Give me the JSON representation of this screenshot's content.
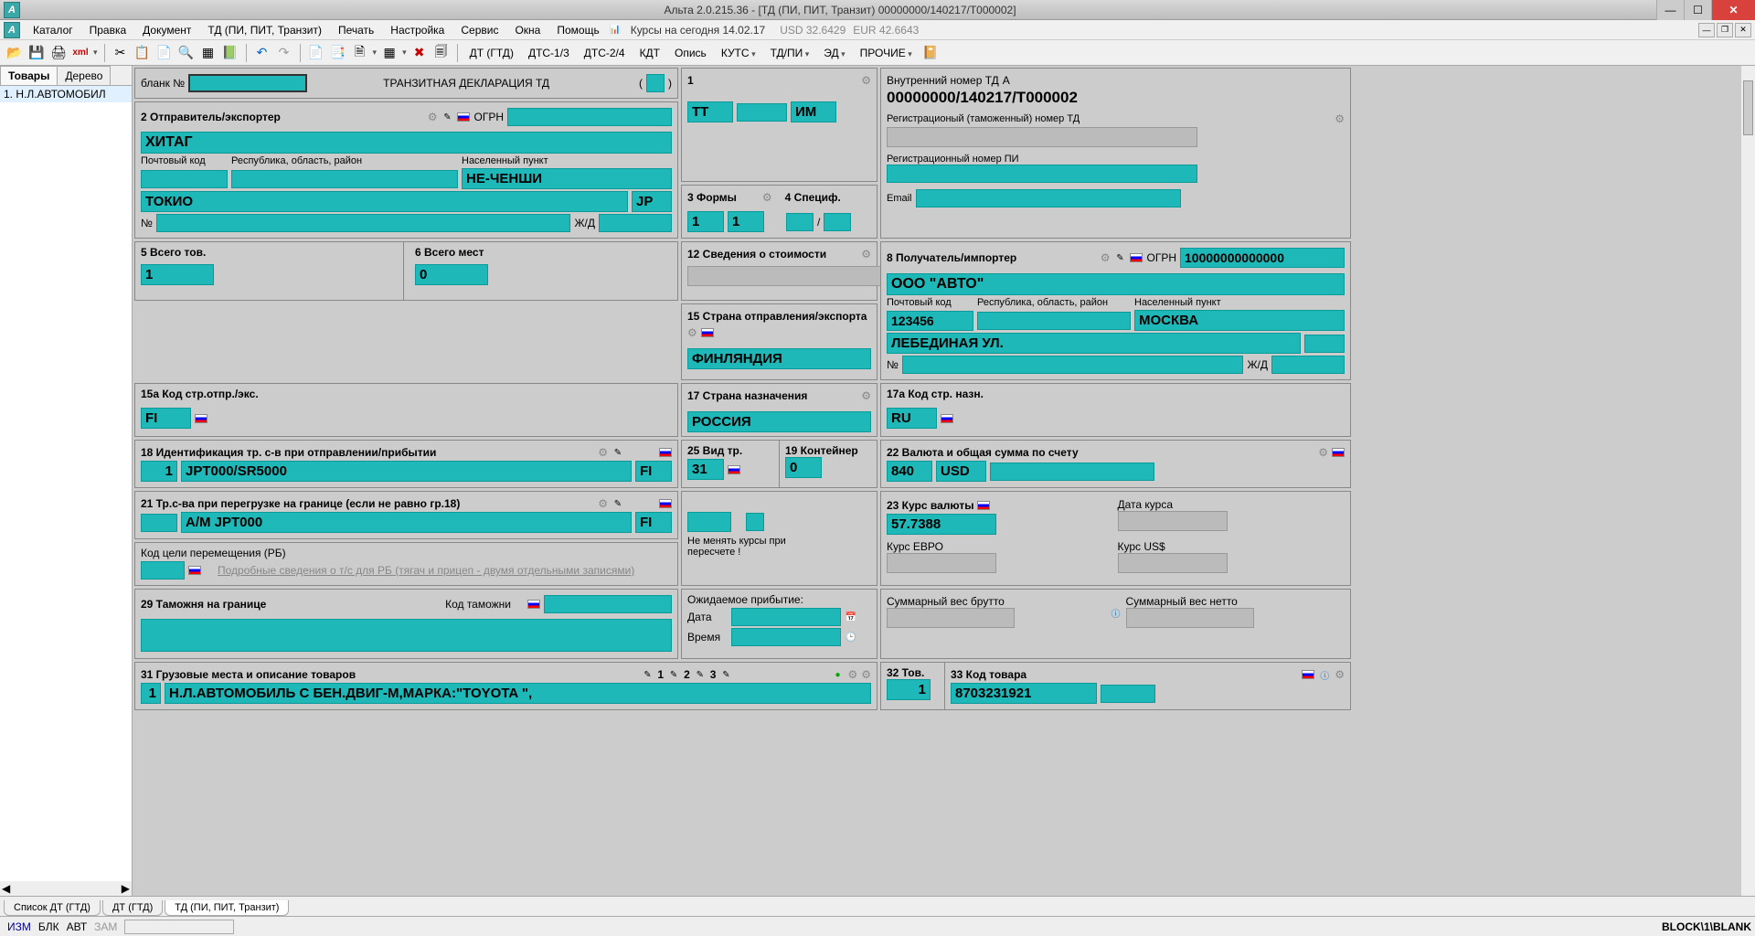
{
  "window": {
    "title": "Альта 2.0.215.36 - [ТД (ПИ, ПИТ, Транзит) 00000000/140217/Т000002]"
  },
  "menu": {
    "items": [
      "Каталог",
      "Правка",
      "Документ",
      "ТД (ПИ, ПИТ, Транзит)",
      "Печать",
      "Настройка",
      "Сервис",
      "Окна",
      "Помощь"
    ],
    "rates_label": "Курсы на сегодня 14.02.17",
    "rates_usd": "USD 32.6429",
    "rates_eur": "EUR 42.6643"
  },
  "toolbar2": {
    "items": [
      "ДТ (ГТД)",
      "ДТС-1/3",
      "ДТС-2/4",
      "КДТ",
      "Опись",
      "КУТС"
    ],
    "dd": [
      "ТД/ПИ",
      "ЭД",
      "ПРОЧИЕ"
    ]
  },
  "side": {
    "tab1": "Товары",
    "tab2": "Дерево",
    "item1": "1. Н.Л.АВТОМОБИЛ"
  },
  "header": {
    "blank": "бланк №",
    "decl_title": "ТРАНЗИТНАЯ ДЕКЛАРАЦИЯ  ТД",
    "r1_lbl": "1",
    "r1_tt": "ТТ",
    "r1_im": "ИМ",
    "inner_lbl": "Внутренний номер ТД",
    "inner_val": "00000000/140217/Т000002",
    "a": "A",
    "reg_custom": "Регистрационый (таможенный) номер ТД",
    "reg_pi": "Регистрационный номер ПИ",
    "email": "Email"
  },
  "b2": {
    "title": "2 Отправитель/экспортер",
    "ogrn": "ОГРН",
    "name": "ХИТАГ",
    "post": "Почтовый код",
    "region": "Республика, область, район",
    "city_lbl": "Населенный пункт",
    "city": "НЕ-ЧЕНШИ",
    "city2": "ТОКИО",
    "country": "JP",
    "no": "№",
    "zd": "Ж/Д"
  },
  "b3": {
    "forms": "3 Формы",
    "v1": "1",
    "v2": "1",
    "spec": "4 Специф.",
    "slash": "/"
  },
  "b5": {
    "total_goods": "5 Всего тов.",
    "v": "1",
    "total_places": "6 Всего мест",
    "p": "0"
  },
  "b12": {
    "lbl": "12 Сведения о стоимости"
  },
  "b8": {
    "title": "8 Получатель/импортер",
    "ogrn": "ОГРН",
    "ogrn_v": "10000000000000",
    "name": "ООО \"АВТО\"",
    "post": "Почтовый код",
    "post_v": "123456",
    "region": "Республика, область, район",
    "city_lbl": "Населенный пункт",
    "city": "МОСКВА",
    "street": "ЛЕБЕДИНАЯ УЛ.",
    "no": "№",
    "zd": "Ж/Д"
  },
  "b15": {
    "lbl": "15 Страна отправления/экспорта",
    "v": "ФИНЛЯНДИЯ",
    "lbl_a": "15a Код стр.отпр./экс.",
    "va": "FI"
  },
  "b17": {
    "lbl": "17 Страна назначения",
    "v": "РОССИЯ",
    "lbl_a": "17a Код стр. назн.",
    "va": "RU"
  },
  "b18": {
    "lbl": "18 Идентификация тр. с-в при отправлении/прибытии",
    "n": "1",
    "v": "JPT000/SR5000",
    "c": "FI"
  },
  "b21": {
    "lbl": "21 Тр.с-ва при перегрузке на границе (если не равно гр.18)",
    "v": "А/М JPT000",
    "c": "FI"
  },
  "b25": {
    "lbl": "25 Вид тр.",
    "v": "31"
  },
  "b19": {
    "lbl": "19 Контейнер",
    "v": "0"
  },
  "b22": {
    "lbl": "22 Валюта и общая сумма по счету",
    "code": "840",
    "cur": "USD"
  },
  "b23": {
    "keep": "Не менять курсы при пересчете !",
    "rate_lbl": "23 Курс валюты",
    "rate": "57.7388",
    "date_lbl": "Дата курса",
    "eur": "Курс ЕВРО",
    "usd": "Курс US$"
  },
  "brb": {
    "lbl": "Код цели перемещения (РБ)",
    "link": "Подробные сведения о т/с для РБ (тягач и прицеп - двумя отдельными записями)"
  },
  "b29": {
    "lbl": "29 Таможня на границе",
    "code": "Код таможни"
  },
  "barr": {
    "lbl": "Ожидаемое прибытие:",
    "date": "Дата",
    "time": "Время"
  },
  "bw": {
    "brutto": "Суммарный вес брутто",
    "netto": "Суммарный вес нетто"
  },
  "b31": {
    "lbl": "31 Грузовые места и описание товаров",
    "p1": "1",
    "p2": "2",
    "p3": "3",
    "n": "1",
    "desc": "Н.Л.АВТОМОБИЛЬ С БЕН.ДВИГ-М,МАРКА:\"TOYOTA \","
  },
  "b32": {
    "lbl": "32 Тов.",
    "v": "1"
  },
  "b33": {
    "lbl": "33 Код товара",
    "v": "8703231921"
  },
  "btabs": {
    "t1": "Список ДТ (ГТД)",
    "t2": "ДТ (ГТД)",
    "t3": "ТД (ПИ, ПИТ, Транзит)"
  },
  "status": {
    "izm": "ИЗМ",
    "blk": "БЛК",
    "avt": "АВТ",
    "zam": "ЗАМ",
    "path": "BLOCK\\1\\BLANK"
  }
}
